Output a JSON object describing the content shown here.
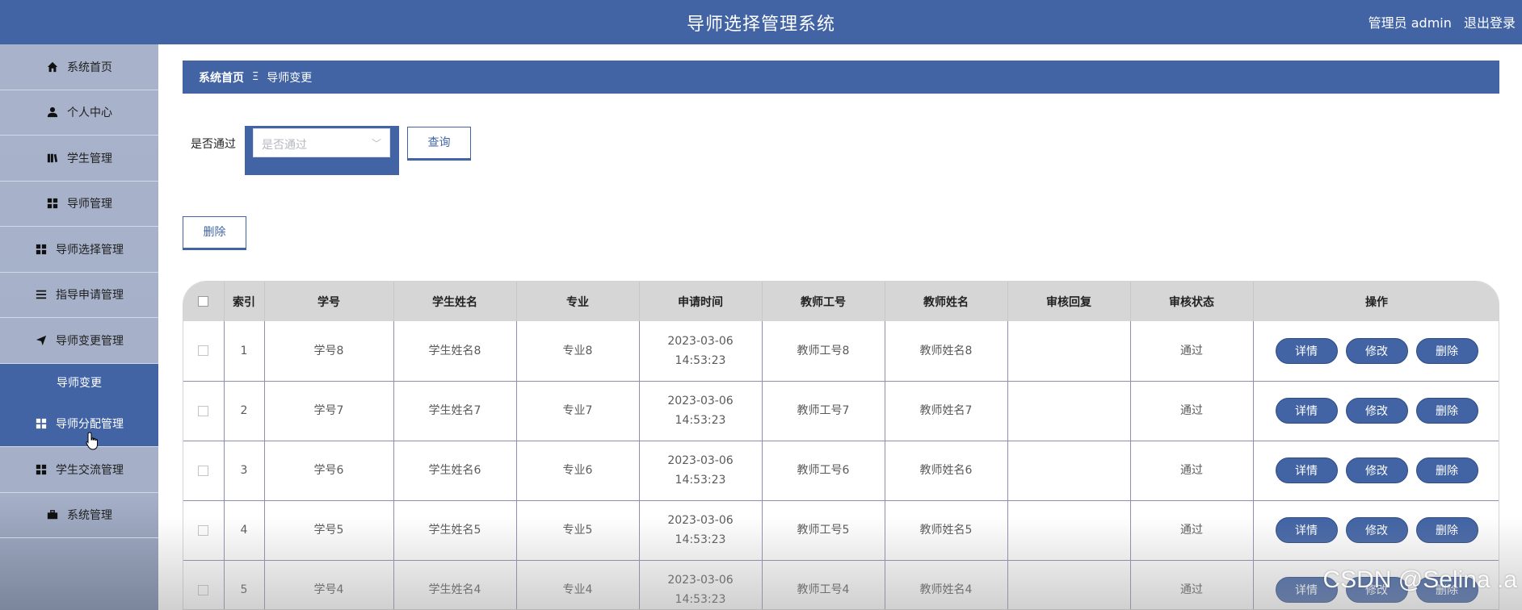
{
  "header": {
    "title": "导师选择管理系统",
    "user_label": "管理员 admin",
    "logout_label": "退出登录"
  },
  "sidebar": {
    "items": [
      {
        "label": "系统首页",
        "icon": "home-icon"
      },
      {
        "label": "个人中心",
        "icon": "user-icon"
      },
      {
        "label": "学生管理",
        "icon": "book-icon"
      },
      {
        "label": "导师管理",
        "icon": "grid-icon"
      },
      {
        "label": "导师选择管理",
        "icon": "grid-icon"
      },
      {
        "label": "指导申请管理",
        "icon": "list-icon"
      },
      {
        "label": "导师变更管理",
        "icon": "send-icon"
      }
    ],
    "sub_item": "导师变更",
    "items_after": [
      {
        "label": "导师分配管理",
        "icon": "grid-icon"
      },
      {
        "label": "学生交流管理",
        "icon": "grid-icon"
      },
      {
        "label": "系统管理",
        "icon": "briefcase-icon"
      }
    ]
  },
  "breadcrumb": {
    "home": "系统首页",
    "separator": "Ξ",
    "current": "导师变更"
  },
  "filter": {
    "label": "是否通过",
    "placeholder": "是否通过",
    "query_button": "查询"
  },
  "toolbar": {
    "delete_button": "删除"
  },
  "table": {
    "headers": [
      "索引",
      "学号",
      "学生姓名",
      "专业",
      "申请时间",
      "教师工号",
      "教师姓名",
      "审核回复",
      "审核状态",
      "操作"
    ],
    "rows": [
      {
        "index": "1",
        "student_no": "学号8",
        "student_name": "学生姓名8",
        "major": "专业8",
        "time": "2023-03-06 14:53:23",
        "teacher_no": "教师工号8",
        "teacher_name": "教师姓名8",
        "reply": "",
        "status": "通过"
      },
      {
        "index": "2",
        "student_no": "学号7",
        "student_name": "学生姓名7",
        "major": "专业7",
        "time": "2023-03-06 14:53:23",
        "teacher_no": "教师工号7",
        "teacher_name": "教师姓名7",
        "reply": "",
        "status": "通过"
      },
      {
        "index": "3",
        "student_no": "学号6",
        "student_name": "学生姓名6",
        "major": "专业6",
        "time": "2023-03-06 14:53:23",
        "teacher_no": "教师工号6",
        "teacher_name": "教师姓名6",
        "reply": "",
        "status": "通过"
      },
      {
        "index": "4",
        "student_no": "学号5",
        "student_name": "学生姓名5",
        "major": "专业5",
        "time": "2023-03-06 14:53:23",
        "teacher_no": "教师工号5",
        "teacher_name": "教师姓名5",
        "reply": "",
        "status": "通过"
      },
      {
        "index": "5",
        "student_no": "学号4",
        "student_name": "学生姓名4",
        "major": "专业4",
        "time": "2023-03-06 14:53:23",
        "teacher_no": "教师工号4",
        "teacher_name": "教师姓名4",
        "reply": "",
        "status": "通过"
      }
    ],
    "actions": [
      "详情",
      "修改",
      "删除"
    ]
  },
  "watermark": "CSDN @Selina .a",
  "colors": {
    "primary": "#4264a5",
    "sidebar": "#a8b3cb",
    "header_row": "#d6d6d6"
  }
}
